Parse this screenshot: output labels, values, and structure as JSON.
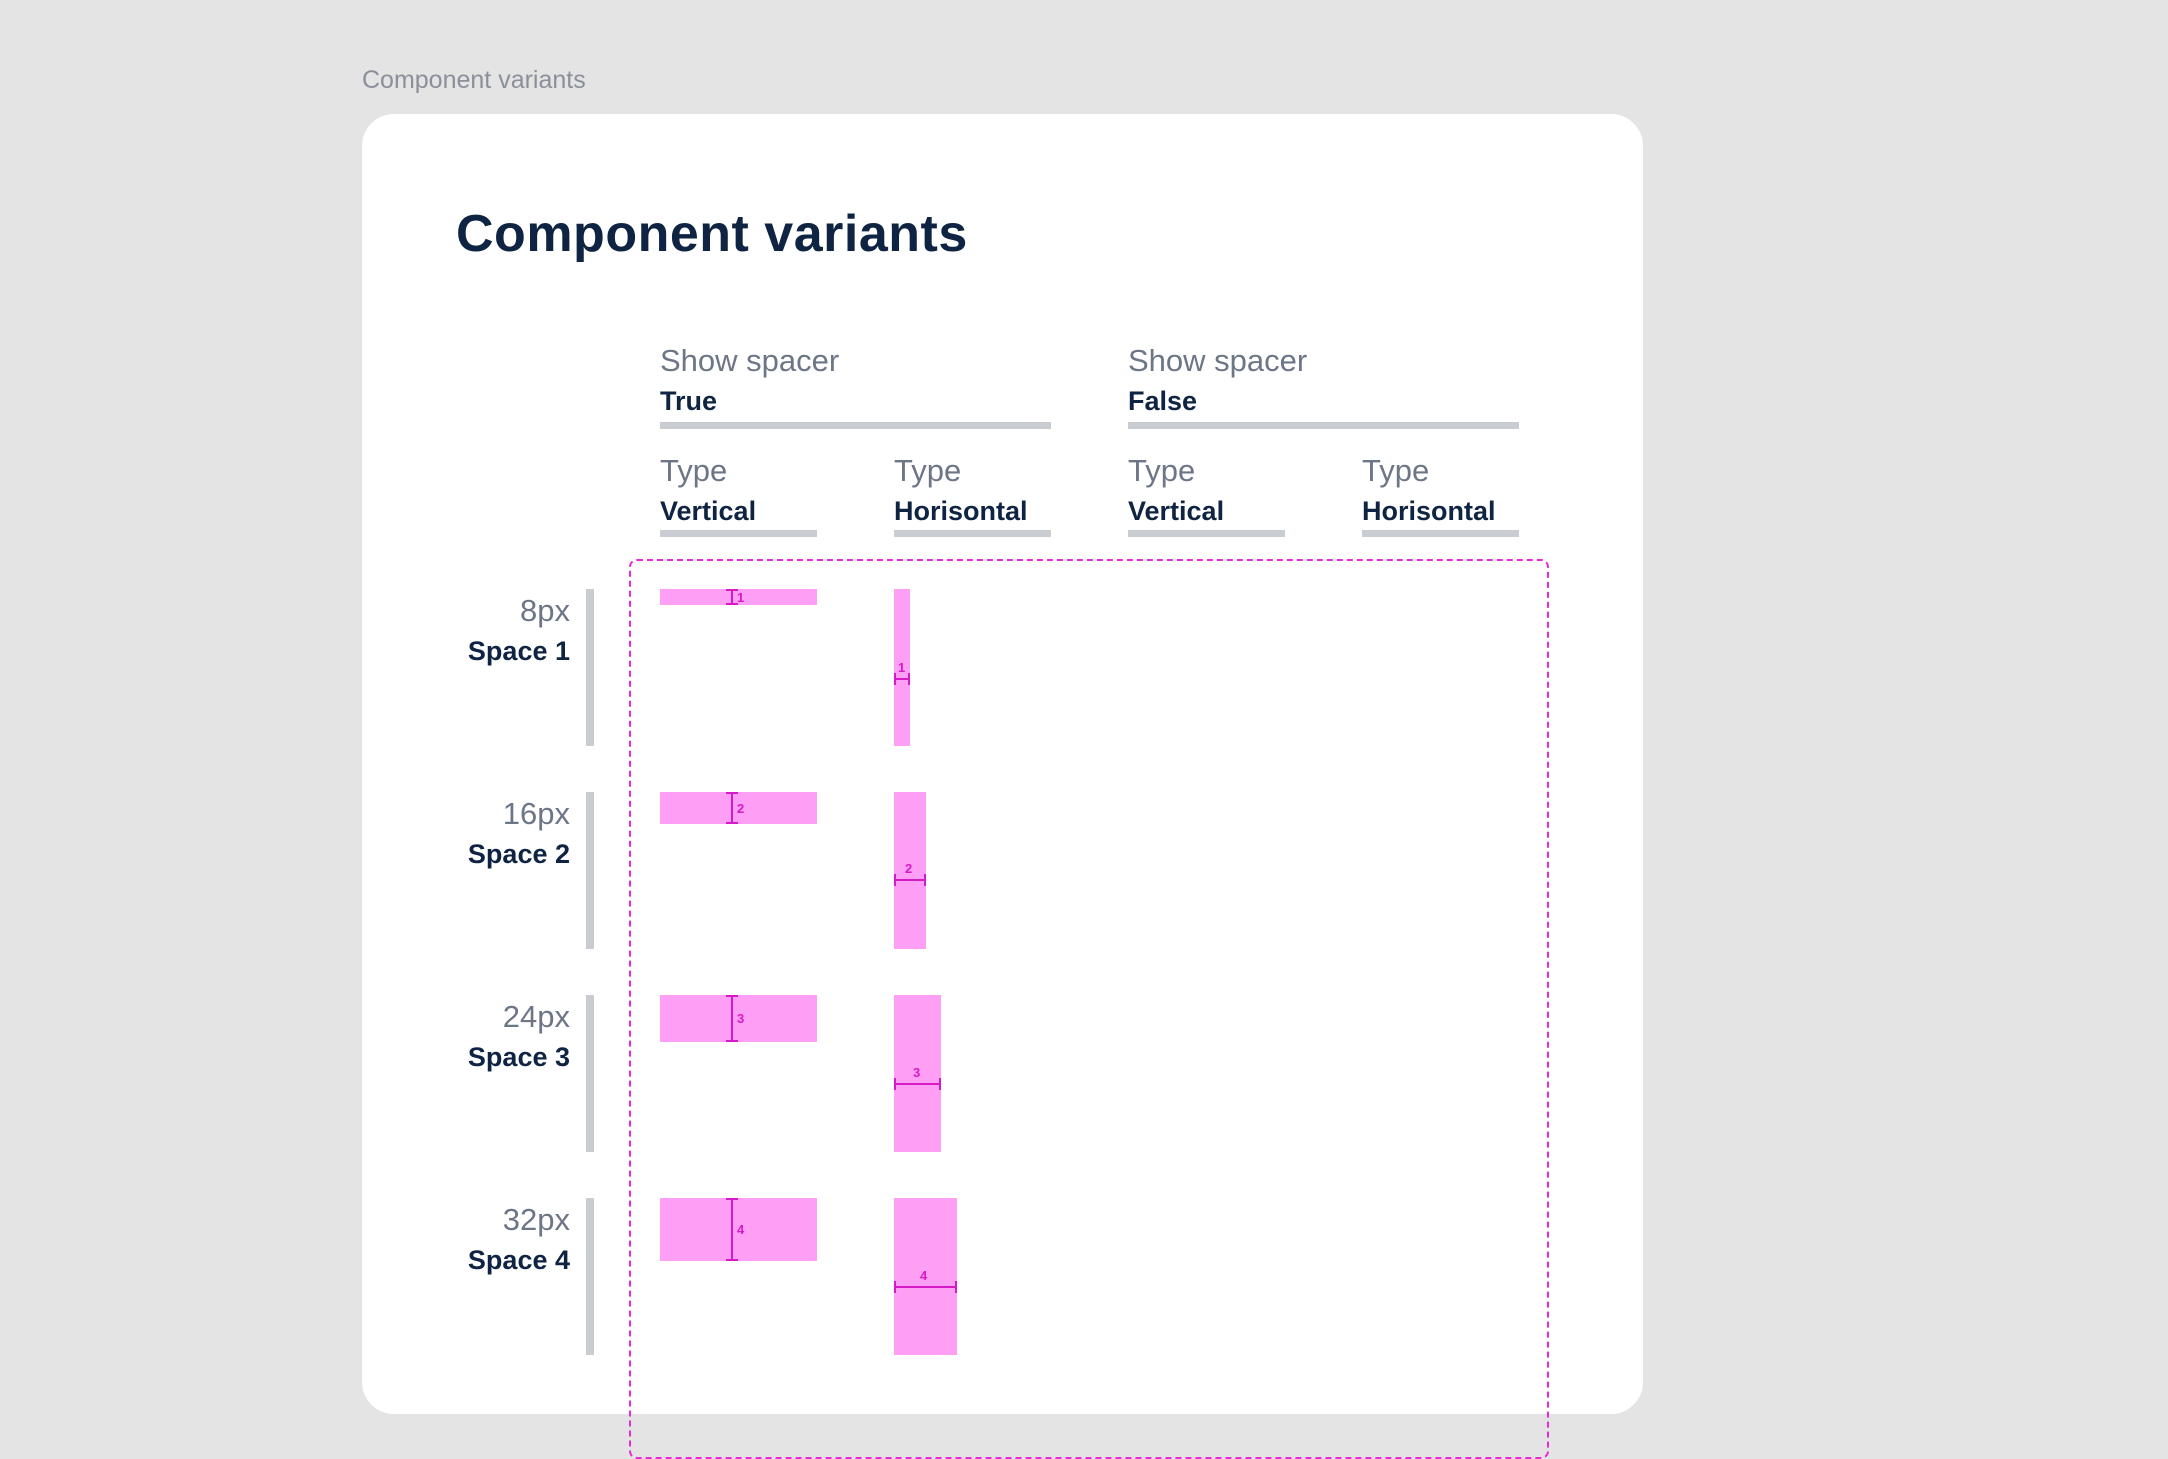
{
  "frame_label": "Component variants",
  "title": "Component variants",
  "group_headers": [
    {
      "key": "Show spacer",
      "value": "True"
    },
    {
      "key": "Show spacer",
      "value": "False"
    }
  ],
  "column_headers": [
    {
      "key": "Type",
      "value": "Vertical"
    },
    {
      "key": "Type",
      "value": "Horisontal"
    },
    {
      "key": "Type",
      "value": "Vertical"
    },
    {
      "key": "Type",
      "value": "Horisontal"
    }
  ],
  "rows": [
    {
      "size": "8px",
      "name": "Space 1",
      "marker": "1"
    },
    {
      "size": "16px",
      "name": "Space 2",
      "marker": "2"
    },
    {
      "size": "24px",
      "name": "Space 3",
      "marker": "3"
    },
    {
      "size": "32px",
      "name": "Space 4",
      "marker": "4"
    }
  ],
  "colors": {
    "spacer_fill": "#ff9ef5",
    "spacer_marker": "#d61ac6",
    "frame_border": "#e82ad8",
    "title": "#0f2442"
  }
}
